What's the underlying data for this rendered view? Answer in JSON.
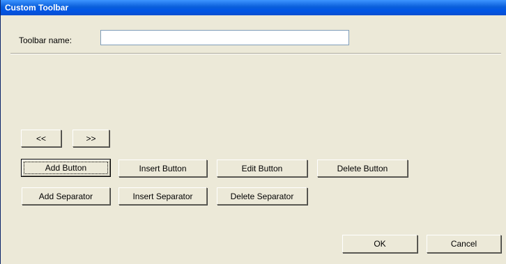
{
  "window": {
    "title": "Custom Toolbar"
  },
  "form": {
    "toolbar_name_label": "Toolbar name:",
    "toolbar_name_value": ""
  },
  "nav": {
    "prev_label": "<<",
    "next_label": ">>"
  },
  "buttons": {
    "add_button": "Add Button",
    "insert_button": "Insert Button",
    "edit_button": "Edit Button",
    "delete_button": "Delete Button",
    "add_separator": "Add Separator",
    "insert_separator": "Insert Separator",
    "delete_separator": "Delete Separator"
  },
  "footer": {
    "ok_label": "OK",
    "cancel_label": "Cancel"
  },
  "colors": {
    "titlebar": "#0055e5",
    "dialog_bg": "#ece9d8"
  }
}
